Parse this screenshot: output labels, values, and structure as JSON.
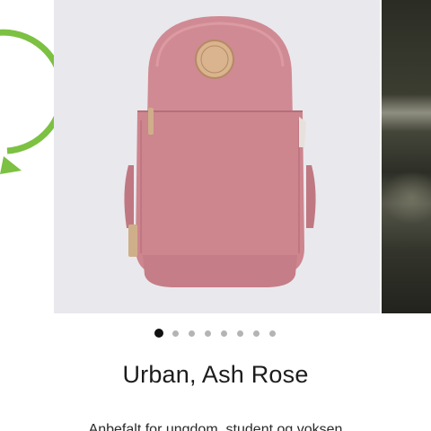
{
  "product": {
    "title": "Urban, Ash Rose",
    "description": "Anbefalt for ungdom, student og voksen"
  },
  "gallery": {
    "total_images": 8,
    "active_index": 0
  },
  "icons": {
    "zoom": "search-icon",
    "previous_slide_decoration": "chat-bubble-icon"
  },
  "colors": {
    "backpack_body": "#d08a93",
    "brand_green": "#7cc142",
    "active_dot": "#111111",
    "inactive_dot": "#b4b4b4"
  }
}
